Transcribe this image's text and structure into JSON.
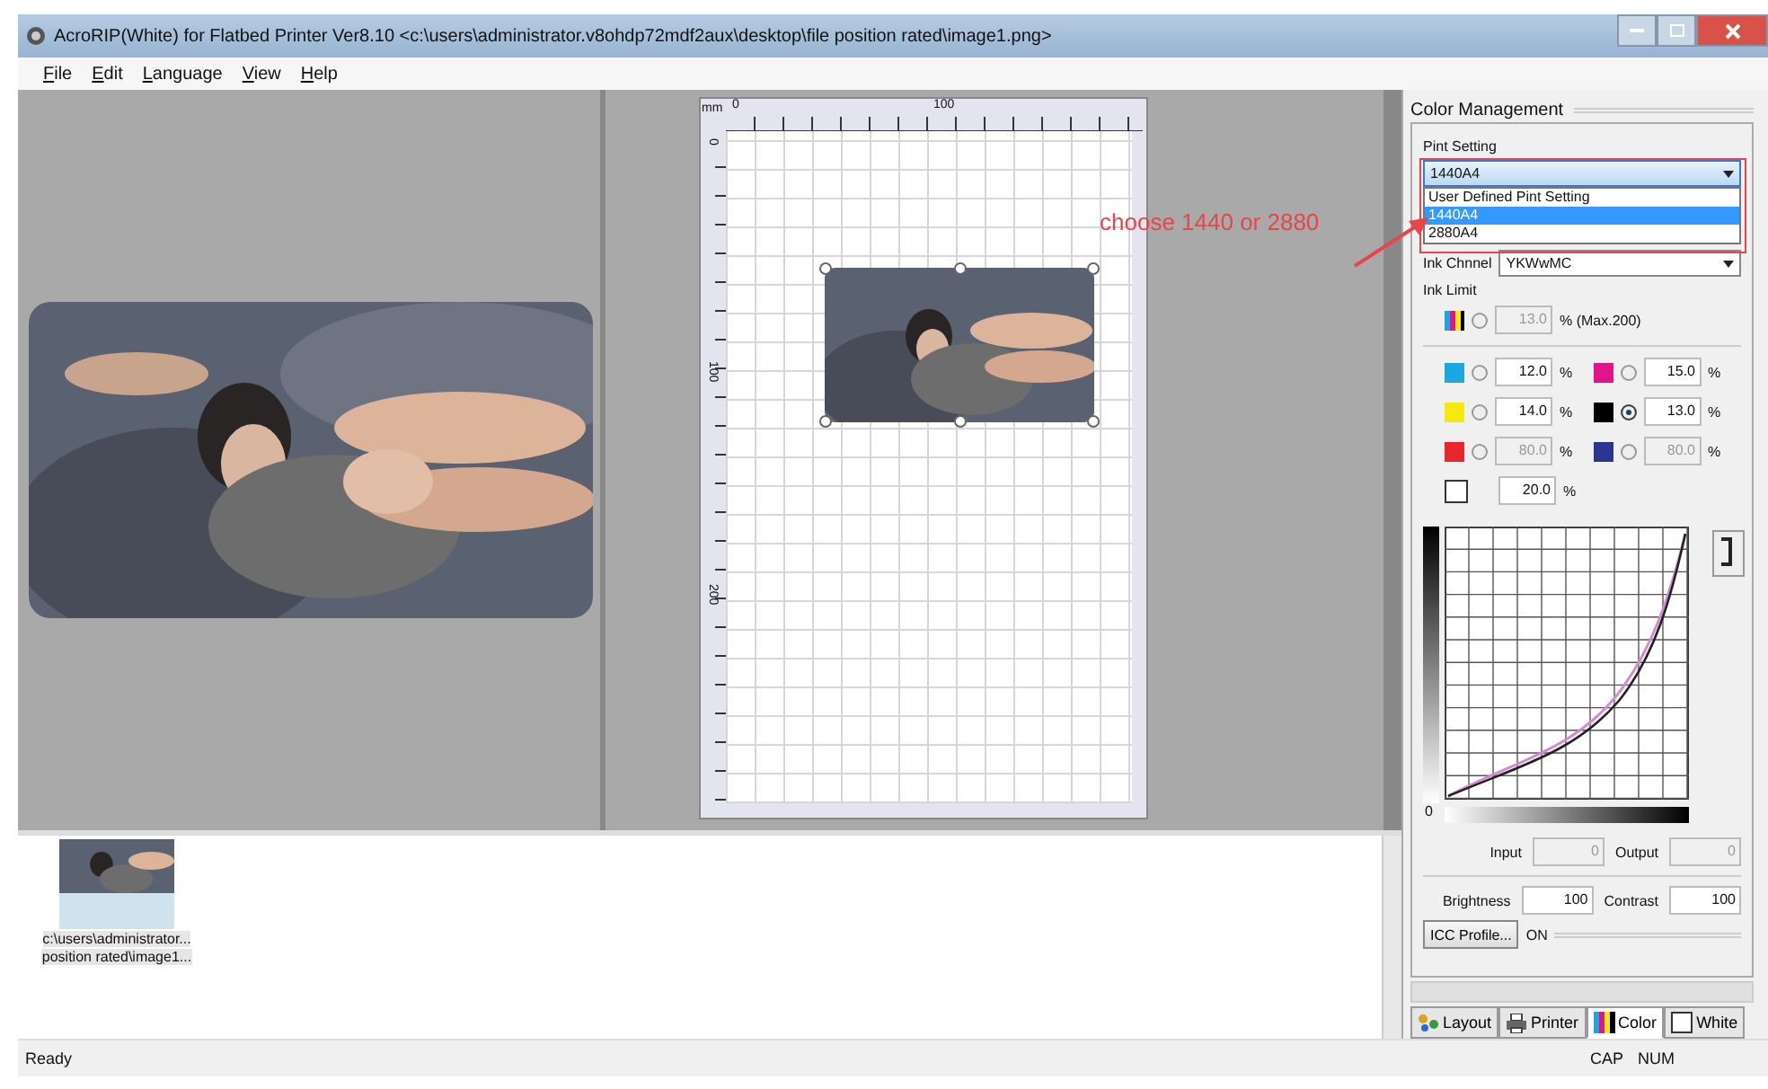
{
  "window": {
    "title": "AcroRIP(White) for Flatbed Printer Ver8.10 <c:\\users\\administrator.v8ohdp72mdf2aux\\desktop\\file position rated\\image1.png>"
  },
  "menu": [
    "File",
    "Edit",
    "Language",
    "View",
    "Help"
  ],
  "preview": {
    "kind": "picture"
  },
  "layout_view": {
    "unit": "mm",
    "x_labels": [
      "0",
      "100"
    ],
    "y_labels": [
      "0",
      "100",
      "200"
    ],
    "image": {
      "kind": "picture"
    }
  },
  "annotation": {
    "text": "choose 1440 or 2880",
    "color": "#e8454a"
  },
  "color_panel": {
    "title": "Color Management",
    "print_setting": {
      "label": "Pint Setting",
      "value": "1440A4",
      "expanded": true,
      "options": [
        {
          "label": "User Defined Pint Setting",
          "selected": false
        },
        {
          "label": "1440A4",
          "selected": true
        },
        {
          "label": "2880A4",
          "selected": false
        }
      ]
    },
    "ink_channel": {
      "label": "Ink Chnnel",
      "value": "YKWwMC"
    },
    "ink_limit": {
      "label": "Ink Limit",
      "total": {
        "value": "13.0",
        "unit": "% (Max.200)",
        "disabled": true,
        "selected": false
      },
      "channels": [
        {
          "kind": "radio",
          "color": "#1aa7e0",
          "value": "12.0",
          "unit": "%",
          "selected": false,
          "disabled": false
        },
        {
          "kind": "radio",
          "color": "#e0158c",
          "value": "15.0",
          "unit": "%",
          "selected": false,
          "disabled": false
        },
        {
          "kind": "radio",
          "color": "#f5e90f",
          "value": "14.0",
          "unit": "%",
          "selected": false,
          "disabled": false
        },
        {
          "kind": "radio",
          "color": "#000000",
          "value": "13.0",
          "unit": "%",
          "selected": true,
          "disabled": false
        },
        {
          "kind": "radio",
          "color": "#e8262d",
          "value": "80.0",
          "unit": "%",
          "selected": false,
          "disabled": true
        },
        {
          "kind": "radio",
          "color": "#2d3593",
          "value": "80.0",
          "unit": "%",
          "selected": false,
          "disabled": true
        },
        {
          "kind": "plain",
          "color": "#ffffff",
          "value": "20.0",
          "unit": "%",
          "disabled": false
        }
      ]
    },
    "curve": {
      "origin_label": "0"
    },
    "input": {
      "label": "Input",
      "value": "0"
    },
    "output": {
      "label": "Output",
      "value": "0"
    },
    "brightness": {
      "label": "Brightness",
      "value": "100"
    },
    "contrast": {
      "label": "Contrast",
      "value": "100"
    },
    "icc": {
      "button": "ICC Profile...",
      "status": "ON"
    },
    "tabs": [
      {
        "label": "Layout",
        "kind": "layout",
        "selected": false
      },
      {
        "label": "Printer",
        "kind": "printer",
        "selected": false
      },
      {
        "label": "Color",
        "kind": "color",
        "selected": true
      },
      {
        "label": "White",
        "kind": "white",
        "selected": false
      }
    ]
  },
  "thumbnails": [
    {
      "caption": [
        "c:\\users\\administrator...",
        "position rated\\image1..."
      ],
      "selected": true
    }
  ],
  "status_bar": {
    "text": "Ready",
    "indicators": [
      "CAP",
      "NUM"
    ]
  }
}
